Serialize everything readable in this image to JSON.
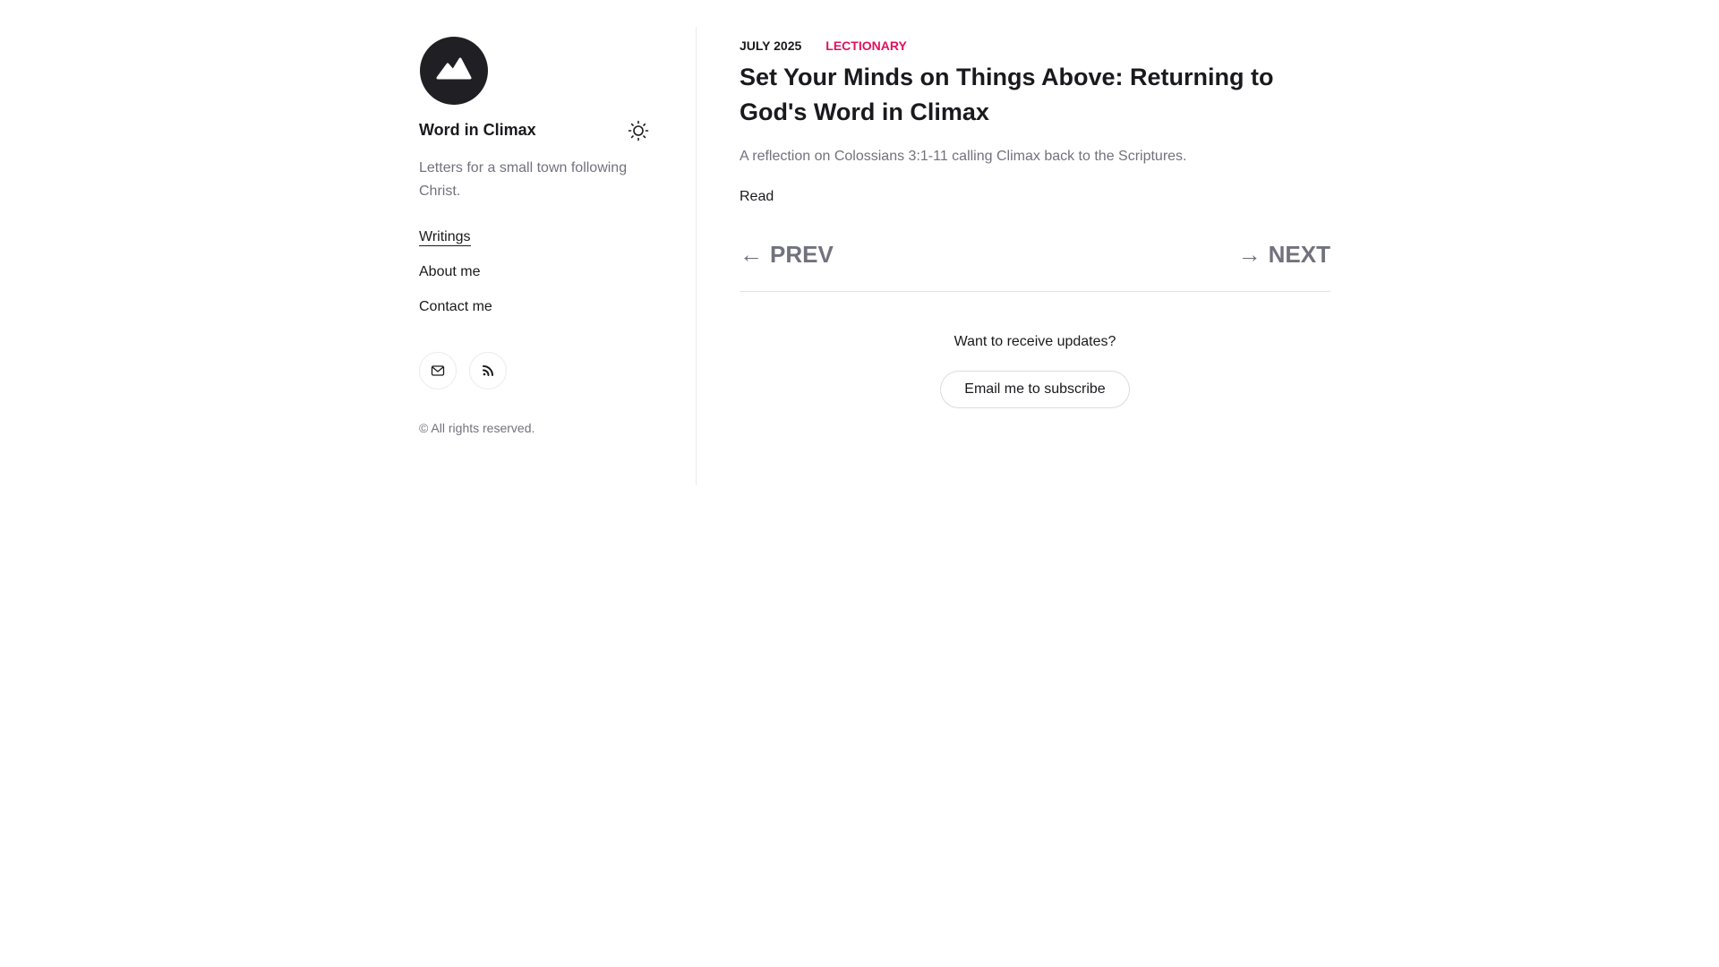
{
  "site": {
    "title": "Word in Climax",
    "tagline": "Letters for a small town following Christ.",
    "copyright": "© All rights reserved."
  },
  "icons": {
    "logo": "mountain-icon",
    "theme_toggle": "sun-icon",
    "email": "mail-icon",
    "rss": "rss-icon"
  },
  "nav": {
    "items": [
      {
        "label": "Writings",
        "active": true
      },
      {
        "label": "About me",
        "active": false
      },
      {
        "label": "Contact me",
        "active": false
      }
    ]
  },
  "post": {
    "date": "JULY 2025",
    "category": "LECTIONARY",
    "title": "Set Your Minds on Things Above: Returning to God's Word in Climax",
    "summary": "A reflection on Colossians 3:1-11 calling Climax back to the Scriptures.",
    "read_label": "Read"
  },
  "pagination": {
    "prev_arrow": "←",
    "prev_label": "PREV",
    "next_arrow": "→",
    "next_label": "NEXT"
  },
  "subscribe": {
    "prompt": "Want to receive updates?",
    "button_label": "Email me to subscribe"
  },
  "colors": {
    "accent": "#e0115f",
    "text": "#1a1a1e",
    "muted": "#72727e"
  }
}
